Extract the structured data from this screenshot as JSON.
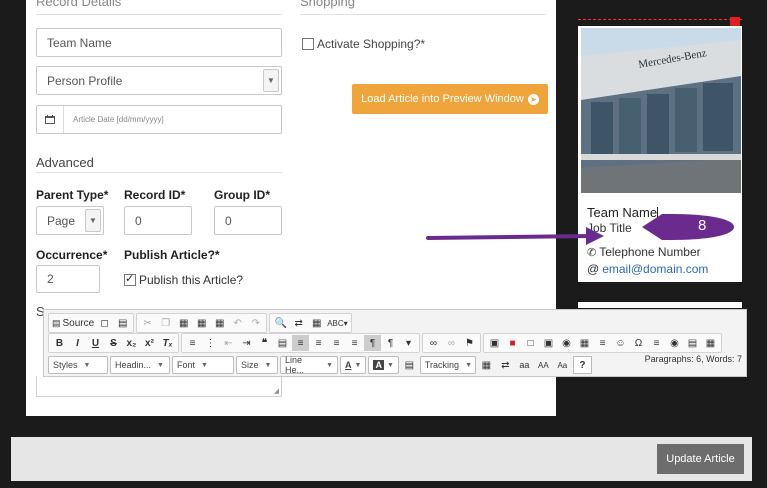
{
  "form": {
    "record_details_heading": "Record Details",
    "team_name_value": "Team Name",
    "person_profile_value": "Person Profile",
    "article_date_placeholder": "Article Date [dd/mm/yyyy]",
    "advanced_heading": "Advanced",
    "parent_type_label": "Parent Type*",
    "record_id_label": "Record ID*",
    "group_id_label": "Group ID*",
    "parent_type_value": "Page",
    "record_id_value": "0",
    "group_id_value": "0",
    "occurrence_label": "Occurrence*",
    "publish_label": "Publish Article?*",
    "occurrence_value": "2",
    "publish_checkbox_label": "Publish this Article?",
    "partial_letter": "S"
  },
  "shopping": {
    "heading": "Shopping",
    "activate_label": "Activate Shopping?*",
    "load_button_label": "Load Article into Preview Window"
  },
  "preview": {
    "team_name": "Team Name",
    "job_title": "Job Title",
    "telephone": "Telephone Number",
    "email": "email@domain.com",
    "step_number": "8",
    "building_sign": "Mercedes-Benz"
  },
  "editor": {
    "row1": {
      "source_label": "Source",
      "spell_label": "ABC"
    },
    "row2": {
      "bold": "B",
      "italic": "I",
      "underline": "U",
      "strike": "S",
      "sub": "x₂",
      "sup": "x²",
      "clear": "Tₓ"
    },
    "row3": {
      "styles": "Styles",
      "heading": "Headin...",
      "font": "Font",
      "size": "Size",
      "line_height": "Line He...",
      "text_color": "A",
      "tracking": "Tracking",
      "case_a": "aa",
      "case_b": "AA",
      "case_c": "Aa",
      "help": "?"
    },
    "status": "Paragraphs: 6, Words: 7"
  },
  "footer": {
    "update_button": "Update Article"
  },
  "colors": {
    "accent_orange": "#f0a43c",
    "annotation_purple": "#6b2b8e",
    "link_blue": "#2a6bb5"
  }
}
